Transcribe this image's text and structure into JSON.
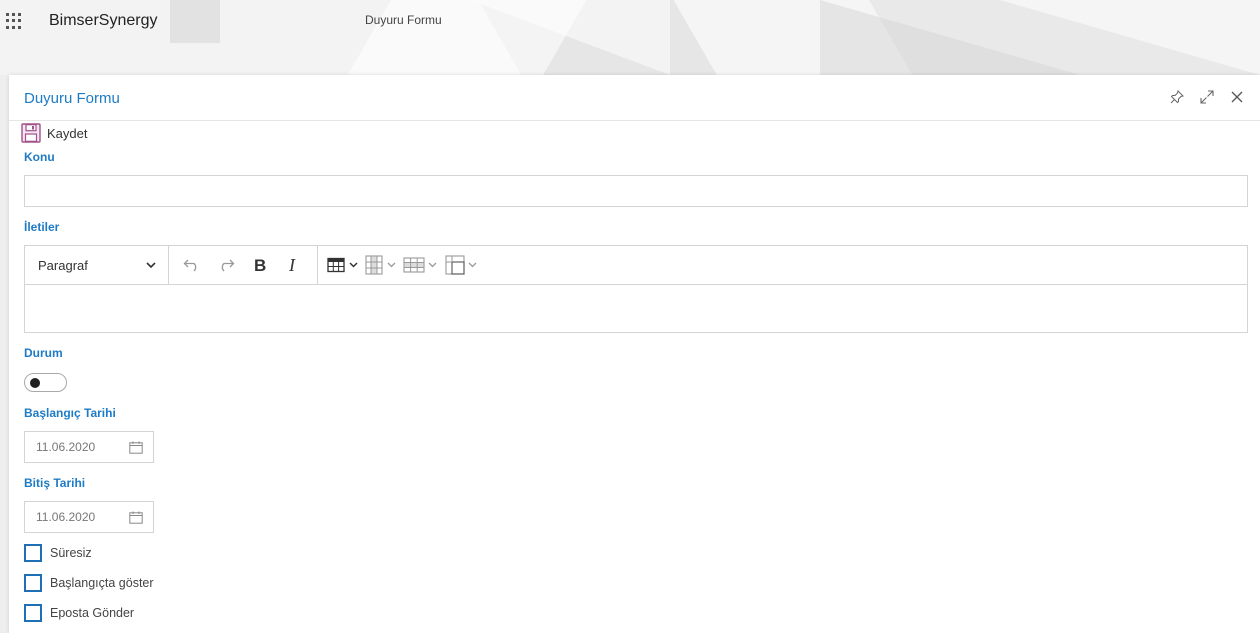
{
  "topbar": {
    "brand": "BimserSynergy",
    "app_title": "Duyuru Formu"
  },
  "panel": {
    "title": "Duyuru Formu",
    "save_label": "Kaydet"
  },
  "form": {
    "subject_label": "Konu",
    "subject_value": "",
    "messages_label": "İletiler",
    "paragraph_select": "Paragraf",
    "status_label": "Durum",
    "status_on": false,
    "start_date_label": "Başlangıç Tarihi",
    "start_date_value": "11.06.2020",
    "end_date_label": "Bitiş Tarihi",
    "end_date_value": "11.06.2020",
    "checkboxes": [
      {
        "label": "Süresiz",
        "checked": false
      },
      {
        "label": "Başlangıçta göster",
        "checked": false
      },
      {
        "label": "Eposta Gönder",
        "checked": false
      }
    ]
  },
  "colors": {
    "accent": "#1e7bc6",
    "checkbox_border": "#1e6fb5"
  }
}
